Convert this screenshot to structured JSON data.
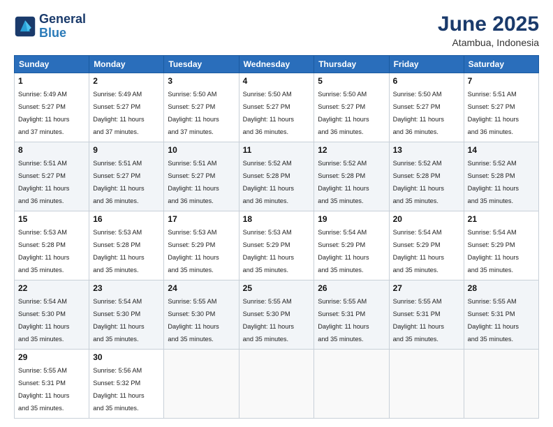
{
  "header": {
    "logo_line1": "General",
    "logo_line2": "Blue",
    "month": "June 2025",
    "location": "Atambua, Indonesia"
  },
  "days_of_week": [
    "Sunday",
    "Monday",
    "Tuesday",
    "Wednesday",
    "Thursday",
    "Friday",
    "Saturday"
  ],
  "weeks": [
    [
      {
        "day": "1",
        "sunrise": "5:49 AM",
        "sunset": "5:27 PM",
        "daylight": "11 hours and 37 minutes."
      },
      {
        "day": "2",
        "sunrise": "5:49 AM",
        "sunset": "5:27 PM",
        "daylight": "11 hours and 37 minutes."
      },
      {
        "day": "3",
        "sunrise": "5:50 AM",
        "sunset": "5:27 PM",
        "daylight": "11 hours and 37 minutes."
      },
      {
        "day": "4",
        "sunrise": "5:50 AM",
        "sunset": "5:27 PM",
        "daylight": "11 hours and 36 minutes."
      },
      {
        "day": "5",
        "sunrise": "5:50 AM",
        "sunset": "5:27 PM",
        "daylight": "11 hours and 36 minutes."
      },
      {
        "day": "6",
        "sunrise": "5:50 AM",
        "sunset": "5:27 PM",
        "daylight": "11 hours and 36 minutes."
      },
      {
        "day": "7",
        "sunrise": "5:51 AM",
        "sunset": "5:27 PM",
        "daylight": "11 hours and 36 minutes."
      }
    ],
    [
      {
        "day": "8",
        "sunrise": "5:51 AM",
        "sunset": "5:27 PM",
        "daylight": "11 hours and 36 minutes."
      },
      {
        "day": "9",
        "sunrise": "5:51 AM",
        "sunset": "5:27 PM",
        "daylight": "11 hours and 36 minutes."
      },
      {
        "day": "10",
        "sunrise": "5:51 AM",
        "sunset": "5:27 PM",
        "daylight": "11 hours and 36 minutes."
      },
      {
        "day": "11",
        "sunrise": "5:52 AM",
        "sunset": "5:28 PM",
        "daylight": "11 hours and 36 minutes."
      },
      {
        "day": "12",
        "sunrise": "5:52 AM",
        "sunset": "5:28 PM",
        "daylight": "11 hours and 35 minutes."
      },
      {
        "day": "13",
        "sunrise": "5:52 AM",
        "sunset": "5:28 PM",
        "daylight": "11 hours and 35 minutes."
      },
      {
        "day": "14",
        "sunrise": "5:52 AM",
        "sunset": "5:28 PM",
        "daylight": "11 hours and 35 minutes."
      }
    ],
    [
      {
        "day": "15",
        "sunrise": "5:53 AM",
        "sunset": "5:28 PM",
        "daylight": "11 hours and 35 minutes."
      },
      {
        "day": "16",
        "sunrise": "5:53 AM",
        "sunset": "5:28 PM",
        "daylight": "11 hours and 35 minutes."
      },
      {
        "day": "17",
        "sunrise": "5:53 AM",
        "sunset": "5:29 PM",
        "daylight": "11 hours and 35 minutes."
      },
      {
        "day": "18",
        "sunrise": "5:53 AM",
        "sunset": "5:29 PM",
        "daylight": "11 hours and 35 minutes."
      },
      {
        "day": "19",
        "sunrise": "5:54 AM",
        "sunset": "5:29 PM",
        "daylight": "11 hours and 35 minutes."
      },
      {
        "day": "20",
        "sunrise": "5:54 AM",
        "sunset": "5:29 PM",
        "daylight": "11 hours and 35 minutes."
      },
      {
        "day": "21",
        "sunrise": "5:54 AM",
        "sunset": "5:29 PM",
        "daylight": "11 hours and 35 minutes."
      }
    ],
    [
      {
        "day": "22",
        "sunrise": "5:54 AM",
        "sunset": "5:30 PM",
        "daylight": "11 hours and 35 minutes."
      },
      {
        "day": "23",
        "sunrise": "5:54 AM",
        "sunset": "5:30 PM",
        "daylight": "11 hours and 35 minutes."
      },
      {
        "day": "24",
        "sunrise": "5:55 AM",
        "sunset": "5:30 PM",
        "daylight": "11 hours and 35 minutes."
      },
      {
        "day": "25",
        "sunrise": "5:55 AM",
        "sunset": "5:30 PM",
        "daylight": "11 hours and 35 minutes."
      },
      {
        "day": "26",
        "sunrise": "5:55 AM",
        "sunset": "5:31 PM",
        "daylight": "11 hours and 35 minutes."
      },
      {
        "day": "27",
        "sunrise": "5:55 AM",
        "sunset": "5:31 PM",
        "daylight": "11 hours and 35 minutes."
      },
      {
        "day": "28",
        "sunrise": "5:55 AM",
        "sunset": "5:31 PM",
        "daylight": "11 hours and 35 minutes."
      }
    ],
    [
      {
        "day": "29",
        "sunrise": "5:55 AM",
        "sunset": "5:31 PM",
        "daylight": "11 hours and 35 minutes."
      },
      {
        "day": "30",
        "sunrise": "5:56 AM",
        "sunset": "5:32 PM",
        "daylight": "11 hours and 35 minutes."
      },
      null,
      null,
      null,
      null,
      null
    ]
  ]
}
